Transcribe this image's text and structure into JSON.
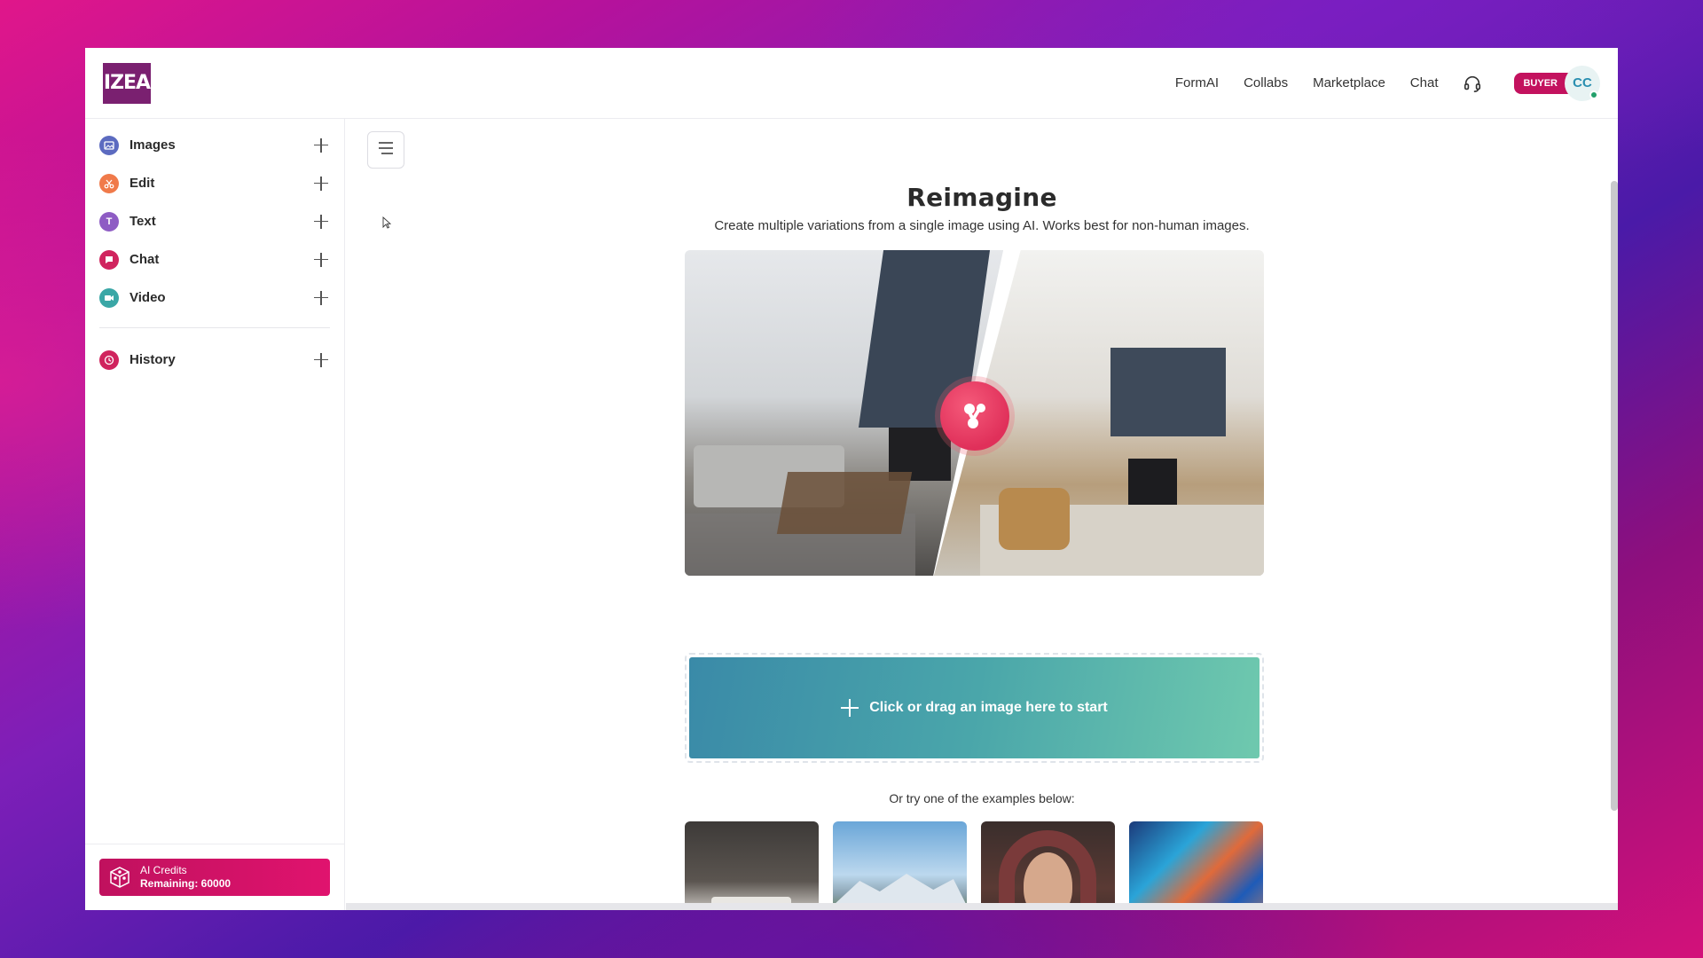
{
  "header": {
    "logo_text": "IZEA",
    "nav": [
      "FormAI",
      "Collabs",
      "Marketplace",
      "Chat"
    ],
    "badge": "BUYER",
    "avatar_initials": "CC"
  },
  "sidebar": {
    "items": [
      {
        "label": "Images",
        "icon": "images-icon",
        "color": "#5c6bc0"
      },
      {
        "label": "Edit",
        "icon": "scissors-icon",
        "color": "#f07a4a"
      },
      {
        "label": "Text",
        "icon": "text-t-icon",
        "color": "#8e5cc4"
      },
      {
        "label": "Chat",
        "icon": "chat-bubble-icon",
        "color": "#d0245e"
      },
      {
        "label": "Video",
        "icon": "video-camera-icon",
        "color": "#3aa7a6"
      }
    ],
    "history": {
      "label": "History",
      "icon": "clock-icon",
      "color": "#d0245e"
    },
    "credits": {
      "title": "AI Credits",
      "remaining": "Remaining: 60000"
    }
  },
  "main": {
    "title": "Reimagine",
    "subtitle": "Create multiple variations from a single image using AI. Works best for non-human images.",
    "dropzone_label": "Click or drag an image here to start",
    "examples_label": "Or try one of the examples below:",
    "examples": [
      "bedroom-example",
      "mountain-example",
      "portrait-example",
      "abstract-example"
    ]
  },
  "colors": {
    "brand": "#7a2070",
    "accent": "#c3125e",
    "dropzone_start": "#3a8aa8",
    "dropzone_end": "#6fc9ae"
  }
}
